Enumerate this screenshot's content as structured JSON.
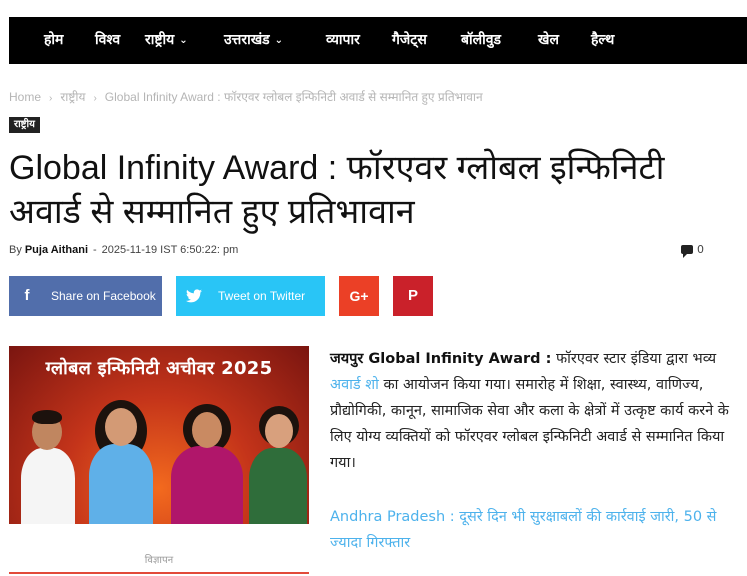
{
  "nav": {
    "items": [
      {
        "label": "होम",
        "has_dropdown": false
      },
      {
        "label": "विश्व",
        "has_dropdown": false
      },
      {
        "label": "राष्ट्रीय",
        "has_dropdown": true
      },
      {
        "label": "उत्तराखंड",
        "has_dropdown": true
      },
      {
        "label": "व्यापार",
        "has_dropdown": false
      },
      {
        "label": "गैजेट्स",
        "has_dropdown": false
      },
      {
        "label": "बॉलीवुड",
        "has_dropdown": false
      },
      {
        "label": "खेल",
        "has_dropdown": false
      },
      {
        "label": "हैल्थ",
        "has_dropdown": false
      }
    ],
    "chevron": "⌄"
  },
  "breadcrumb": {
    "home": "Home",
    "category": "राष्ट्रीय",
    "current": "Global Infinity Award : फॉरएवर ग्लोबल इन्फिनिटी अवार्ड से सम्मानित हुए प्रतिभावान",
    "separator": "›"
  },
  "article": {
    "category_tag": "राष्ट्रीय",
    "title": "Global Infinity Award : फॉरएवर ग्लोबल इन्फिनिटी अवार्ड से सम्मानित हुए प्रतिभावान",
    "by": "By",
    "author": "Puja Aithani",
    "date_sep": "-",
    "date": "2025-11-19 IST 6:50:22: pm",
    "comments_count": "0"
  },
  "share": {
    "facebook_label": "Share on Facebook",
    "twitter_label": "Tweet on Twitter",
    "facebook_icon": "f",
    "googleplus_icon": "G+",
    "pinterest_icon": "P",
    "colors": {
      "facebook": "#516eab",
      "twitter": "#29c5f6",
      "googleplus": "#eb4026",
      "pinterest": "#ca212a"
    }
  },
  "featured_image": {
    "banner_text": "ग्लोबल इन्फिनिटी अचीवर 2025"
  },
  "ad": {
    "label": "विज्ञापन"
  },
  "content": {
    "lead_bold": "जयपुर Global Infinity Award :",
    "text_before_link": " फॉरएवर स्टार इंडिया द्वारा भव्य ",
    "link_text": "अवार्ड शो",
    "text_after_link": " का आयोजन किया गया। समारोह में शिक्षा, स्वास्थ्य, वाणिज्य, प्रौद्योगिकी, कानून, सामाजिक सेवा और कला के क्षेत्रों में उत्कृष्ट कार्य करने के लिए योग्य व्यक्तियों को फॉरएवर ग्लोबल इन्फिनिटी अवार्ड से सम्मानित किया गया।",
    "related_link": "Andhra Pradesh : दूसरे दिन भी सुरक्षाबलों की कार्रवाई जारी, 50 से ज्यादा गिरफ्तार",
    "link_color": "#4db2ec"
  }
}
